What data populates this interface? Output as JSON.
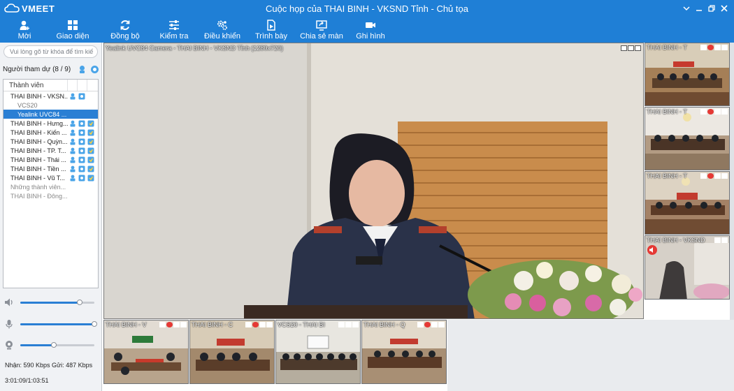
{
  "app": {
    "logo": "VMEET",
    "window_title": "Cuộc họp của THAI BINH - VKSND Tỉnh - Chủ tọa",
    "window_controls": [
      "chevron-down-icon",
      "minimize-icon",
      "restore-icon",
      "close-icon"
    ]
  },
  "toolbar": {
    "items": [
      {
        "label": "Mời",
        "icon": "invite-user-icon"
      },
      {
        "label": "Giao diện",
        "icon": "layout-grid-icon"
      },
      {
        "label": "Đồng bộ",
        "icon": "sync-icon"
      },
      {
        "label": "Kiểm tra",
        "icon": "sliders-icon"
      },
      {
        "label": "Điều khiển",
        "icon": "control-gears-icon"
      },
      {
        "label": "Trình bày",
        "icon": "present-icon"
      },
      {
        "label": "Chia sẻ màn",
        "icon": "share-screen-icon"
      },
      {
        "label": "Ghi hình",
        "icon": "record-camera-icon"
      }
    ]
  },
  "sidebar": {
    "search_placeholder": "Vui lòng gõ từ khóa để tìm kiế",
    "participants_label": "Người tham dự (8 / 9)",
    "column_header": "Thành viên",
    "members": [
      {
        "name": "THAI BINH - VKSN...",
        "type": "main"
      },
      {
        "name": "VCS20",
        "type": "sub"
      },
      {
        "name": "Yealink UVC84 ...",
        "type": "sub-selected"
      },
      {
        "name": "THAI BINH - Hưng...",
        "type": "main"
      },
      {
        "name": "THAI BINH - Kiến ...",
        "type": "main"
      },
      {
        "name": "THAI BINH - Quỳn...",
        "type": "main"
      },
      {
        "name": "THAI BINH - TP. T...",
        "type": "main"
      },
      {
        "name": "THAI BINH - Thái ...",
        "type": "main"
      },
      {
        "name": "THAI BINH - Tiền ...",
        "type": "main"
      },
      {
        "name": "THAI BINH - Vũ T...",
        "type": "main"
      },
      {
        "name": "Những thành viên...",
        "type": "grey"
      },
      {
        "name": "THAI BINH - Đông...",
        "type": "grey"
      }
    ],
    "speaker_volume": 0.8,
    "mic_volume": 1.0,
    "camera_level": 0.45,
    "bitrate": "Nhận: 590 Kbps Gửi: 487 Kbps",
    "timer": "3:01:09/1:03:51"
  },
  "main_video": {
    "label": "Yealink UVC84 Camera - THAI BINH - VKSND Tỉnh (1280x720)"
  },
  "right_thumbs": [
    {
      "label": "THAI BINH - T"
    },
    {
      "label": "THAI BINH - T"
    },
    {
      "label": "THAI BINH - T"
    },
    {
      "label": "THAI BINH - VKSND"
    }
  ],
  "bottom_thumbs": [
    {
      "label": "THAI BINH - V"
    },
    {
      "label": "THAI BINH - C"
    },
    {
      "label": "VCS20 - THAI BI"
    },
    {
      "label": "THAI BINH - Q"
    }
  ],
  "colors": {
    "accent": "#1f7fd6",
    "selected": "#2a7fd4",
    "muted_red": "#e53935"
  }
}
